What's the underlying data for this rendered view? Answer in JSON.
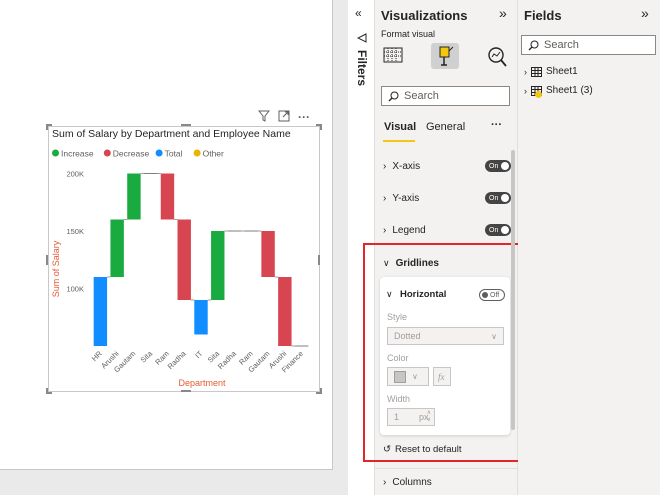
{
  "visual": {
    "title": "Sum of Salary by Department and Employee Name",
    "legend": [
      {
        "label": "Increase",
        "color": "#1aab40"
      },
      {
        "label": "Decrease",
        "color": "#d64550"
      },
      {
        "label": "Total",
        "color": "#118dff"
      },
      {
        "label": "Other",
        "color": "#e8b400"
      }
    ],
    "icons": [
      "filter-icon",
      "focus-mode-icon",
      "more-options-icon"
    ]
  },
  "chart_data": {
    "type": "waterfall",
    "title": "Sum of Salary by Department and Employee Name",
    "xlabel": "Department",
    "ylabel": "Sum of Salary",
    "y_ticks": [
      "100K",
      "150K",
      "200K"
    ],
    "ylim": [
      50000,
      210000
    ],
    "categories": [
      "HR",
      "Arushi",
      "Gautam",
      "Sita",
      "Ram",
      "Radha",
      "IT",
      "Sita",
      "Radha",
      "Ram",
      "Gautam",
      "Arushi",
      "Finance"
    ],
    "kind": [
      "total",
      "increase",
      "increase",
      "increase",
      "decrease",
      "decrease",
      "total",
      "increase",
      "increase",
      "decrease",
      "decrease",
      "decrease",
      "total"
    ],
    "start": [
      50000,
      110000,
      160000,
      200000,
      200000,
      160000,
      60000,
      90000,
      150000,
      150000,
      150000,
      110000,
      50000
    ],
    "end": [
      110000,
      160000,
      200000,
      200000,
      160000,
      90000,
      90000,
      150000,
      150000,
      150000,
      110000,
      50000,
      50000
    ],
    "colors": {
      "increase": "#1aab40",
      "decrease": "#d64550",
      "total": "#118dff"
    }
  },
  "filters_pane": {
    "label": "Filters",
    "collapse_icon": "chevron-left-double-icon"
  },
  "viz_pane": {
    "title": "Visualizations",
    "format_visual": "Format visual",
    "search_placeholder": "Search",
    "tabs": {
      "visual": "Visual",
      "general": "General",
      "more": "···"
    },
    "sections": {
      "xaxis": "X-axis",
      "yaxis": "Y-axis",
      "legend": "Legend",
      "gridlines": "Gridlines",
      "columns": "Columns"
    },
    "toggles": {
      "on": "On",
      "off": "Off"
    },
    "horizontal": "Horizontal",
    "style_label": "Style",
    "style_value": "Dotted",
    "color_label": "Color",
    "width_label": "Width",
    "width_value": "1",
    "width_unit": "px",
    "reset": "Reset to default"
  },
  "fields_pane": {
    "title": "Fields",
    "search_placeholder": "Search",
    "items": [
      "Sheet1",
      "Sheet1 (3)"
    ]
  }
}
